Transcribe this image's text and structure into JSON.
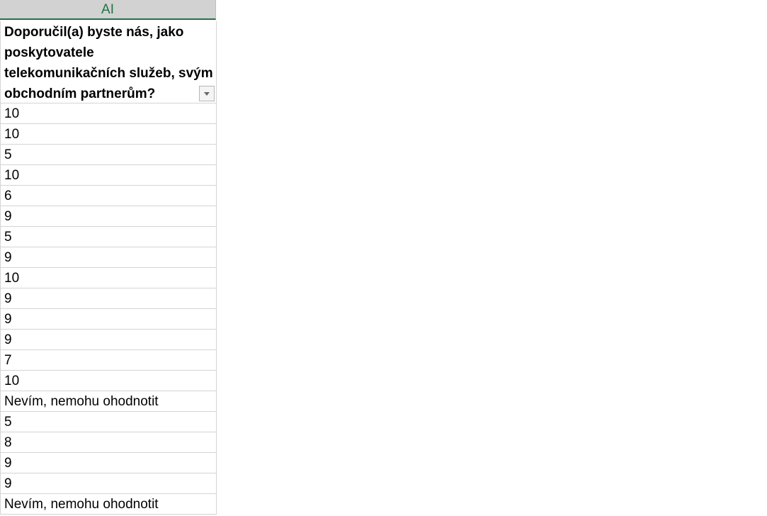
{
  "column": {
    "letter": "AI"
  },
  "header": {
    "text": "Doporučil(a) byste nás, jako poskytovatele telekomunikačních služeb, svým obchodním partnerům?"
  },
  "rows": [
    "10",
    "10",
    "5",
    "10",
    "6",
    "9",
    "5",
    "9",
    "10",
    "9",
    "9",
    "9",
    "7",
    "10",
    "Nevím, nemohu ohodnotit",
    "5",
    "8",
    "9",
    "9",
    "Nevím, nemohu ohodnotit"
  ],
  "icons": {
    "filter": "filter-dropdown-icon"
  },
  "colors": {
    "column_header_text": "#217346",
    "column_header_bg": "#d2d2d2",
    "gridline": "#d4d4d4"
  }
}
